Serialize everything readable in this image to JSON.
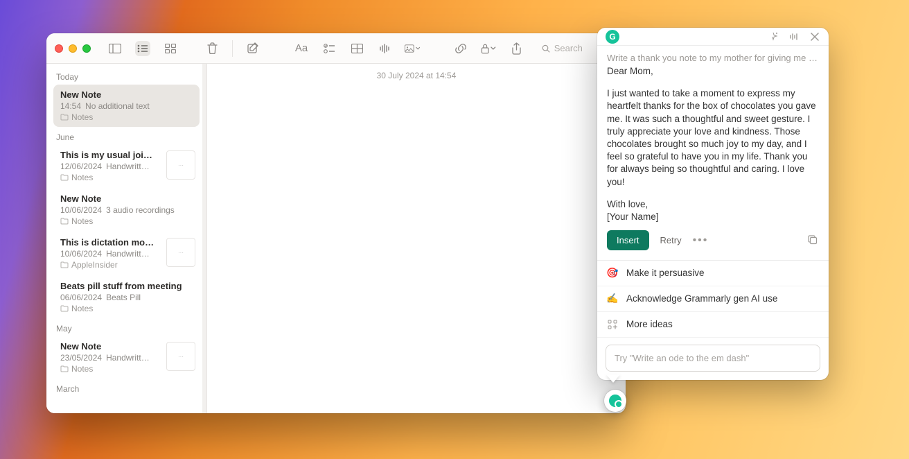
{
  "toolbar": {
    "search_placeholder": "Search",
    "text_style_label": "Aa"
  },
  "editor": {
    "date_line": "30 July 2024 at 14:54"
  },
  "sidebar": {
    "sections": [
      {
        "label": "Today",
        "items": [
          {
            "title": "New Note",
            "date": "14:54",
            "subtitle": "No additional text",
            "folder": "Notes",
            "selected": true,
            "thumb": false
          }
        ]
      },
      {
        "label": "June",
        "items": [
          {
            "title": "This is my usual joi…",
            "date": "12/06/2024",
            "subtitle": "Handwritt…",
            "folder": "Notes",
            "thumb": true
          },
          {
            "title": "New Note",
            "date": "10/06/2024",
            "subtitle": "3 audio recordings",
            "folder": "Notes",
            "thumb": false
          },
          {
            "title": "This is dictation mo…",
            "date": "10/06/2024",
            "subtitle": "Handwritt…",
            "folder": "AppleInsider",
            "thumb": true
          },
          {
            "title": "Beats pill stuff from meeting",
            "date": "06/06/2024",
            "subtitle": "Beats Pill",
            "folder": "Notes",
            "thumb": false
          }
        ]
      },
      {
        "label": "May",
        "items": [
          {
            "title": "New Note",
            "date": "23/05/2024",
            "subtitle": "Handwritt…",
            "folder": "Notes",
            "thumb": true
          }
        ]
      },
      {
        "label": "March",
        "items": []
      }
    ]
  },
  "grammarly": {
    "prompt_preview": "Write a thank you note to my mother for giving me a …",
    "salutation": "Dear Mom,",
    "body": "I just wanted to take a moment to express my heartfelt thanks for the box of chocolates you gave me. It was such a thoughtful and sweet gesture. I truly appreciate your love and kindness. Those chocolates brought so much joy to my day, and I feel so grateful to have you in my life. Thank you for always being so thoughtful and caring. I love you!",
    "closing1": "With love,",
    "closing2": "[Your Name]",
    "insert_label": "Insert",
    "retry_label": "Retry",
    "suggestions": {
      "persuasive": "Make it persuasive",
      "acknowledge": "Acknowledge Grammarly gen AI use",
      "more": "More ideas"
    },
    "input_placeholder": "Try \"Write an ode to the em dash\""
  }
}
